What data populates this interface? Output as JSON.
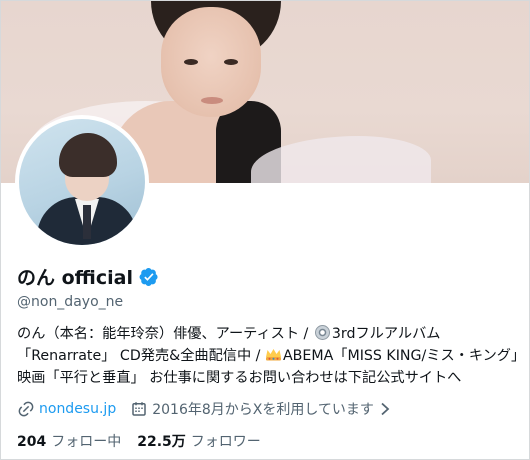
{
  "profile": {
    "name": "のん official",
    "handle": "@non_dayo_ne",
    "verified": true,
    "bio_line1_a": "のん（本名：能年玲奈）俳優、アーティスト /",
    "bio_line1_b": "3rdフルアルバム",
    "bio_line2_a": "「Renarrate」 CD発売&全曲配信中 /",
    "bio_line2_b": "ABEMA「MISS KING/ミス・キング」",
    "bio_line3": "映画「平行と垂直」 お仕事に関するお問い合わせは下記公式サイトへ",
    "website": "nondesu.jp",
    "joined": "2016年8月からXを利用しています"
  },
  "stats": {
    "following_count": "204",
    "following_label": "フォロー中",
    "followers_count": "22.5万",
    "followers_label": "フォロワー"
  },
  "icons": {
    "verified": "verified-badge-icon",
    "disc": "cd-disc-icon",
    "crown": "crown-icon",
    "link": "link-icon",
    "calendar": "calendar-icon",
    "chevron": "chevron-right-icon"
  },
  "colors": {
    "accent": "#1d9bf0",
    "text_primary": "#0f1419",
    "text_secondary": "#536471"
  }
}
